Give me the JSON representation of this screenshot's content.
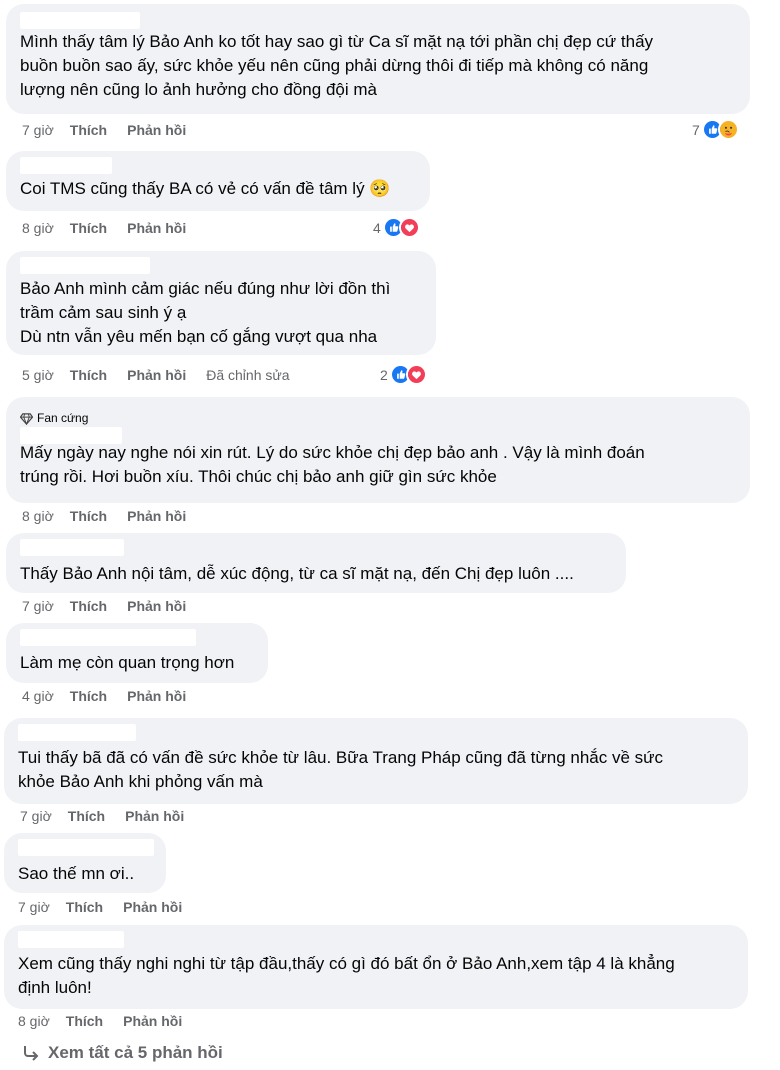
{
  "comments": [
    {
      "lines": [
        "Mình thấy tâm lý Bảo Anh ko tốt hay sao gì từ Ca sĩ mặt nạ tới phần chị đẹp cứ thấy",
        "buồn buồn sao ấy, sức khỏe yếu nên cũng phải dừng thôi đi tiếp mà không có năng",
        "lượng nên cũng lo ảnh hưởng cho đồng đội mà"
      ],
      "time": "7 giờ",
      "like": "Thích",
      "reply": "Phản hồi",
      "reaction_count": "7",
      "reactions": [
        "like",
        "care"
      ]
    },
    {
      "lines": [
        "Coi TMS cũng thấy BA có vẻ có vấn đề tâm lý 🥺"
      ],
      "time": "8 giờ",
      "like": "Thích",
      "reply": "Phản hồi",
      "reaction_count": "4",
      "reactions": [
        "like",
        "love"
      ]
    },
    {
      "lines": [
        "Bảo Anh mình cảm giác nếu đúng như lời đồn thì",
        "trầm cảm sau sinh ý ạ",
        "Dù ntn vẫn yêu mến bạn cố gắng vượt qua nha"
      ],
      "time": "5 giờ",
      "like": "Thích",
      "reply": "Phản hồi",
      "edited": "Đã chỉnh sửa",
      "reaction_count": "2",
      "reactions": [
        "like",
        "love"
      ]
    },
    {
      "badge": "Fan cứng",
      "lines": [
        "Mấy ngày nay nghe nói xin rút. Lý do sức khỏe chị đẹp bảo anh . Vậy là mình đoán",
        "trúng rồi. Hơi buồn xíu. Thôi chúc chị bảo anh giữ gìn sức khỏe"
      ],
      "time": "8 giờ",
      "like": "Thích",
      "reply": "Phản hồi"
    },
    {
      "lines": [
        "Thấy Bảo Anh nội tâm, dễ xúc động, từ ca sĩ mặt nạ, đến Chị đẹp luôn ...."
      ],
      "time": "7 giờ",
      "like": "Thích",
      "reply": "Phản hồi"
    },
    {
      "lines": [
        "Làm mẹ còn quan trọng hơn"
      ],
      "time": "4 giờ",
      "like": "Thích",
      "reply": "Phản hồi"
    },
    {
      "lines": [
        "Tui thấy bã đã có vấn đề sức khỏe từ lâu. Bữa Trang Pháp cũng đã từng nhắc về sức",
        "khỏe Bảo Anh khi phỏng vấn mà"
      ],
      "time": "7 giờ",
      "like": "Thích",
      "reply": "Phản hồi"
    },
    {
      "lines": [
        "Sao thế mn ơi.."
      ],
      "time": "7 giờ",
      "like": "Thích",
      "reply": "Phản hồi"
    },
    {
      "lines": [
        "Xem cũng thấy nghi nghi từ tập đầu,thấy có gì đó bất ổn ở Bảo Anh,xem tập 4 là khẳng",
        "định luôn!"
      ],
      "time": "8 giờ",
      "like": "Thích",
      "reply": "Phản hồi"
    }
  ],
  "view_all": "Xem tất cả 5 phản hồi",
  "colors": {
    "bubble": "#f0f2f5",
    "meta": "#65676b",
    "like_blue": "#1877f2",
    "love_red": "#f33e58",
    "care_yellow": "#f7b125"
  }
}
